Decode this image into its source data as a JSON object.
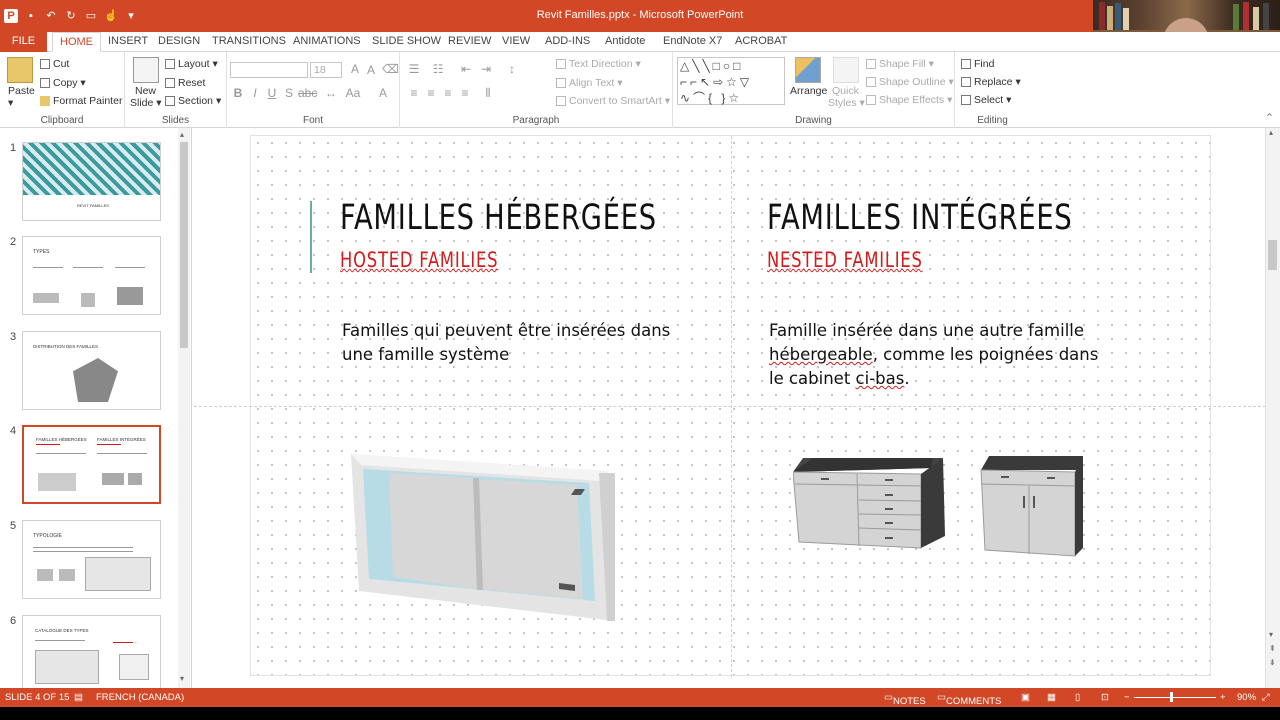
{
  "window": {
    "title": "Revit Familles.pptx - Microsoft PowerPoint"
  },
  "colors": {
    "accent": "#d24726",
    "heading_red": "#d21c1c",
    "teal": "#6aa9b0"
  },
  "tabs": [
    {
      "label": "FILE"
    },
    {
      "label": "HOME"
    },
    {
      "label": "INSERT"
    },
    {
      "label": "DESIGN"
    },
    {
      "label": "TRANSITIONS"
    },
    {
      "label": "ANIMATIONS"
    },
    {
      "label": "SLIDE SHOW"
    },
    {
      "label": "REVIEW"
    },
    {
      "label": "VIEW"
    },
    {
      "label": "ADD-INS"
    },
    {
      "label": "Antidote"
    },
    {
      "label": "EndNote X7"
    },
    {
      "label": "ACROBAT"
    }
  ],
  "ribbon": {
    "clipboard": {
      "paste": "Paste",
      "cut": "Cut",
      "copy": "Copy",
      "format_painter": "Format Painter",
      "label": "Clipboard"
    },
    "slides": {
      "new_slide_1": "New",
      "new_slide_2": "Slide",
      "layout": "Layout",
      "reset": "Reset",
      "section": "Section",
      "label": "Slides"
    },
    "font": {
      "size": "18",
      "label": "Font"
    },
    "paragraph": {
      "text_direction": "Text Direction",
      "align_text": "Align Text",
      "convert_smartart": "Convert to SmartArt",
      "label": "Paragraph"
    },
    "drawing": {
      "arrange": "Arrange",
      "quick_styles_1": "Quick",
      "quick_styles_2": "Styles",
      "shape_fill": "Shape Fill",
      "shape_outline": "Shape Outline",
      "shape_effects": "Shape Effects",
      "label": "Drawing"
    },
    "editing": {
      "find": "Find",
      "replace": "Replace",
      "select": "Select",
      "label": "Editing"
    }
  },
  "thumbnails": [
    {
      "num": "1",
      "title": "REVIT FAMILLES"
    },
    {
      "num": "2",
      "title": "TYPES"
    },
    {
      "num": "3",
      "title": "DISTRIBUTION DES FAMILLES"
    },
    {
      "num": "4",
      "title": "FAMILLES HÉBERGÉES"
    },
    {
      "num": "5",
      "title": "TYPOLOGIE"
    },
    {
      "num": "6",
      "title": "CATALOGUE DES TYPES"
    }
  ],
  "slide": {
    "left_title": "FAMILLES HÉBERGÉES",
    "left_subtitle": "HOSTED FAMILIES",
    "left_body_1": "Familles qui peuvent être insérées dans",
    "left_body_2": "une famille système",
    "right_title": "FAMILLES INTÉGRÉES",
    "right_subtitle": "NESTED FAMILIES",
    "right_body_1": "Famille insérée dans une autre famille",
    "right_body_2a": "hébergeable",
    "right_body_2b": ", comme les poignées dans",
    "right_body_3a": "le cabinet ",
    "right_body_3b": "ci-bas",
    "right_body_3c": "."
  },
  "status": {
    "slide": "SLIDE 4 OF 15",
    "language": "FRENCH (CANADA)",
    "notes": "NOTES",
    "comments": "COMMENTS",
    "zoom": "90%"
  }
}
